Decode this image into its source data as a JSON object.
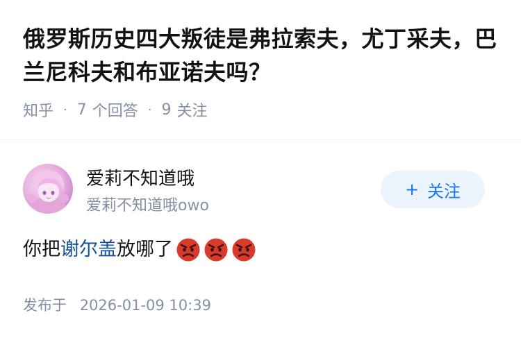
{
  "question": {
    "title": "俄罗斯历史四大叛徒是弗拉索夫，尤丁采夫，巴兰尼科夫和布亚诺夫吗？",
    "source": "知乎",
    "answer_count": "7",
    "answer_label": "个回答",
    "follower_count": "9",
    "follower_label": "关注"
  },
  "author": {
    "name": "爱莉不知道哦",
    "headline": "爱莉不知道哦owo",
    "follow_button": "关注"
  },
  "answer": {
    "text_before": "你把",
    "link_text": "谢尔盖",
    "text_after": "放哪了",
    "emojis": [
      "angry-face-icon",
      "angry-face-icon",
      "angry-face-icon"
    ]
  },
  "publish": {
    "label": "发布于",
    "datetime": "2026-01-09 10:39"
  },
  "colors": {
    "accent": "#1772f6",
    "link": "#175199",
    "muted": "#8590a6",
    "follow_bg": "#ebf4fd",
    "angry_emoji": "#d83a2c"
  }
}
